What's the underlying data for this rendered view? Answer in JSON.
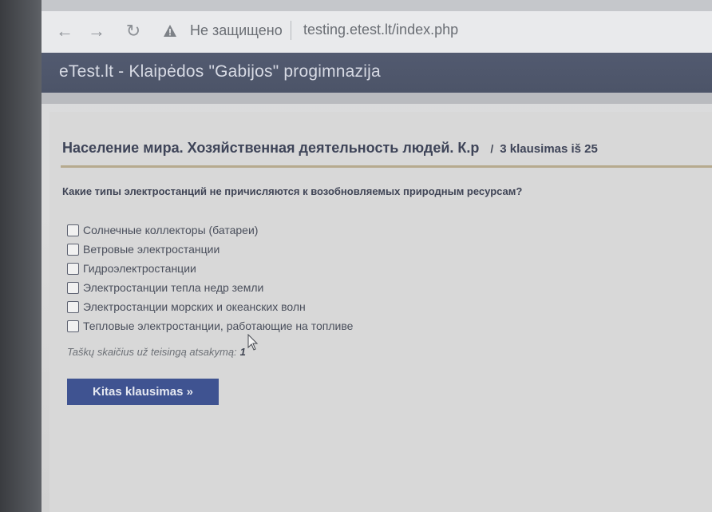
{
  "browser": {
    "insecure_label": "Не защищено",
    "url": "testing.etest.lt/index.php",
    "icons": {
      "back": "arrow-left-icon",
      "forward": "arrow-right-icon",
      "reload": "reload-icon",
      "warning": "warning-triangle-icon"
    }
  },
  "site": {
    "title": "eTest.lt - Klaipėdos \"Gabijos\" progimnazija"
  },
  "test": {
    "title": "Население мира. Хозяйственная деятельность людей. К.р",
    "separator": "/",
    "question_counter": "3 klausimas iš 25"
  },
  "question": {
    "text": "Какие типы электростанций  не причисляются к возобновляемых природным ресурсам?",
    "options": [
      {
        "label": "Солнечные коллекторы (батареи)",
        "checked": false
      },
      {
        "label": "Ветровые электростанции",
        "checked": false
      },
      {
        "label": "Гидроэлектростанции",
        "checked": false
      },
      {
        "label": "Электростанции тепла недр земли",
        "checked": false
      },
      {
        "label": "Электростанции морских и океанских волн",
        "checked": false
      },
      {
        "label": "Тепловые электростанции, работающие на топливе",
        "checked": false
      }
    ]
  },
  "score": {
    "label": "Taškų skaičius už teisingą atsakymą:",
    "value": "1"
  },
  "next_button": {
    "label": "Kitas klausimas »"
  },
  "colors": {
    "header_bg": "#4c5468",
    "button_bg": "#3f5391",
    "heading_rule": "#b6aa8e",
    "page_bg": "#d8d8d8"
  }
}
